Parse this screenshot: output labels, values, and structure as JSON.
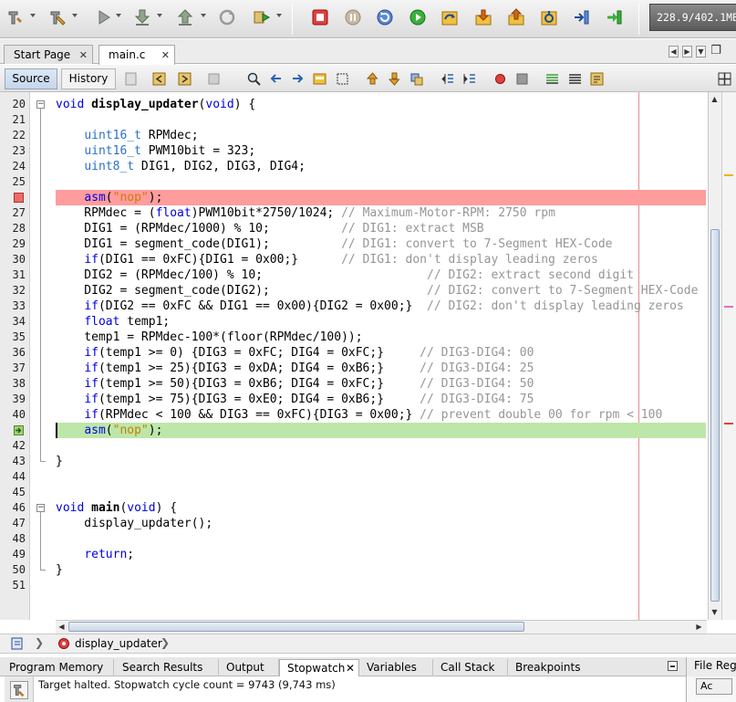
{
  "toolbar": {
    "cycle_readout": "228.9/402.1MB",
    "icons": [
      "build-icon",
      "clean-build-icon",
      "run-icon",
      "program-device-icon",
      "read-device-icon",
      "reset-icon",
      "debug-main-icon",
      "stop-icon",
      "pause-icon",
      "reset-target-icon",
      "continue-icon",
      "step-over-icon",
      "step-into-icon",
      "step-out-icon",
      "run-to-cursor-icon",
      "set-pc-icon",
      "focus-pc-icon"
    ]
  },
  "doc_tabs": [
    {
      "label": "Start Page",
      "active": false
    },
    {
      "label": "main.c",
      "active": true
    }
  ],
  "editor_tabs": {
    "source": "Source",
    "history": "History"
  },
  "code_lines": [
    {
      "n": "20",
      "html": "<span class=\"kw\">void</span> <span class=\"fn\">display_updater</span>(<span class=\"kw\">void</span>) {",
      "fold": "open"
    },
    {
      "n": "21",
      "html": ""
    },
    {
      "n": "22",
      "html": "    <span class=\"ty\">uint16_t</span> RPMdec;"
    },
    {
      "n": "23",
      "html": "    <span class=\"ty\">uint16_t</span> PWM10bit = 323;"
    },
    {
      "n": "24",
      "html": "    <span class=\"ty\">uint8_t</span> DIG1, DIG2, DIG3, DIG4;"
    },
    {
      "n": "25",
      "html": ""
    },
    {
      "n": "",
      "html": "    <span class=\"kw\">asm</span>(<span class=\"str\">\"nop\"</span>);",
      "marker": "breakpoint"
    },
    {
      "n": "27",
      "html": "    RPMdec = (<span class=\"kw\">float</span>)PWM10bit*2750/1024; <span class=\"cm\">// Maximum-Motor-RPM: 2750 rpm</span>"
    },
    {
      "n": "28",
      "html": "    DIG1 = (RPMdec/1000) % 10;          <span class=\"cm\">// DIG1: extract MSB</span>"
    },
    {
      "n": "29",
      "html": "    DIG1 = segment_code(DIG1);          <span class=\"cm\">// DIG1: convert to 7-Segment HEX-Code</span>"
    },
    {
      "n": "30",
      "html": "    <span class=\"kw\">if</span>(DIG1 == 0xFC){DIG1 = 0x00;}      <span class=\"cm\">// DIG1: don't display leading zeros</span>"
    },
    {
      "n": "31",
      "html": "    DIG2 = (RPMdec/100) % 10;                       <span class=\"cm\">// DIG2: extract second digit</span>"
    },
    {
      "n": "32",
      "html": "    DIG2 = segment_code(DIG2);                      <span class=\"cm\">// DIG2: convert to 7-Segment HEX-Code</span>"
    },
    {
      "n": "33",
      "html": "    <span class=\"kw\">if</span>(DIG2 == 0xFC &amp;&amp; DIG1 == 0x00){DIG2 = 0x00;}  <span class=\"cm\">// DIG2: don't display leading zeros</span>"
    },
    {
      "n": "34",
      "html": "    <span class=\"kw\">float</span> temp1;"
    },
    {
      "n": "35",
      "html": "    temp1 = RPMdec-100*(floor(RPMdec/100));"
    },
    {
      "n": "36",
      "html": "    <span class=\"kw\">if</span>(temp1 &gt;= 0) {DIG3 = 0xFC; DIG4 = 0xFC;}     <span class=\"cm\">// DIG3-DIG4: 00</span>"
    },
    {
      "n": "37",
      "html": "    <span class=\"kw\">if</span>(temp1 &gt;= 25){DIG3 = 0xDA; DIG4 = 0xB6;}     <span class=\"cm\">// DIG3-DIG4: 25</span>"
    },
    {
      "n": "38",
      "html": "    <span class=\"kw\">if</span>(temp1 &gt;= 50){DIG3 = 0xB6; DIG4 = 0xFC;}     <span class=\"cm\">// DIG3-DIG4: 50</span>"
    },
    {
      "n": "39",
      "html": "    <span class=\"kw\">if</span>(temp1 &gt;= 75){DIG3 = 0xE0; DIG4 = 0xB6;}     <span class=\"cm\">// DIG3-DIG4: 75</span>"
    },
    {
      "n": "40",
      "html": "    <span class=\"kw\">if</span>(RPMdec &lt; 100 &amp;&amp; DIG3 == 0xFC){DIG3 = 0x00;} <span class=\"cm\">// prevent double 00 for rpm &lt; 100</span>"
    },
    {
      "n": "",
      "html": "    <span class=\"kw\">asm</span>(<span class=\"str\">\"nop\"</span>);",
      "marker": "program-counter"
    },
    {
      "n": "42",
      "html": ""
    },
    {
      "n": "43",
      "html": "}",
      "fold": "end"
    },
    {
      "n": "44",
      "html": ""
    },
    {
      "n": "45",
      "html": ""
    },
    {
      "n": "46",
      "html": "<span class=\"kw\">void</span> <span class=\"fn\">main</span>(<span class=\"kw\">void</span>) {",
      "fold": "open"
    },
    {
      "n": "47",
      "html": "    display_updater();"
    },
    {
      "n": "48",
      "html": ""
    },
    {
      "n": "49",
      "html": "    <span class=\"kw\">return</span>;"
    },
    {
      "n": "50",
      "html": "}",
      "fold": "end"
    },
    {
      "n": "51",
      "html": ""
    }
  ],
  "breadcrumb": {
    "function": "display_updater"
  },
  "output_tabs": [
    {
      "label": "Program Memory",
      "active": false
    },
    {
      "label": "Search Results",
      "active": false
    },
    {
      "label": "Output",
      "active": false
    },
    {
      "label": "Stopwatch",
      "active": true
    },
    {
      "label": "Variables",
      "active": false
    },
    {
      "label": "Call Stack",
      "active": false
    },
    {
      "label": "Breakpoints",
      "active": false
    }
  ],
  "side_panel": {
    "title": "File Reg",
    "button": "Ac"
  },
  "output": {
    "message": "Target halted. Stopwatch cycle count = 9743 (9,743 ms)"
  },
  "colors": {
    "breakpoint_line": "#ff9c9c",
    "pc_line": "#bde7a8",
    "keyword": "#0000e6",
    "type": "#2c6fcb",
    "string": "#ce7b00",
    "comment": "#969696"
  }
}
